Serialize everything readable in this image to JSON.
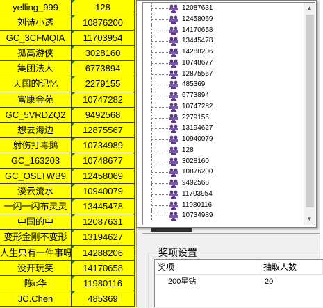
{
  "sheet": {
    "rows": [
      {
        "name": "yelling_999",
        "number": "128"
      },
      {
        "name": "刘诗小透",
        "number": "10876200"
      },
      {
        "name": "GC_3CFMQIA",
        "number": "11703954"
      },
      {
        "name": "孤高游侠",
        "number": "3028160"
      },
      {
        "name": "集团法人",
        "number": "6773894"
      },
      {
        "name": "天国的记忆",
        "number": "2279155"
      },
      {
        "name": "富康金苑",
        "number": "10747282"
      },
      {
        "name": "GC_5VRDZQ2",
        "number": "9492568"
      },
      {
        "name": "想去海边",
        "number": "12875567"
      },
      {
        "name": "射伤打毒鹅",
        "number": "10734989"
      },
      {
        "name": "GC_163203",
        "number": "10748677"
      },
      {
        "name": "GC_OSLTWB9",
        "number": "12458069"
      },
      {
        "name": "淡云流水",
        "number": "10940079"
      },
      {
        "name": "一闪一闪布灵灵",
        "number": "13445478"
      },
      {
        "name": "中国的中",
        "number": "12087631"
      },
      {
        "name": "变形金刚不变形",
        "number": "13194627"
      },
      {
        "name": "人生只有一件事呀",
        "number": "14288206"
      },
      {
        "name": "没开玩笑",
        "number": "14170658"
      },
      {
        "name": "陈c华",
        "number": "11980116"
      },
      {
        "name": "JC.Chen",
        "number": "485369"
      }
    ],
    "colors": {
      "cell_bg": "#ffff00",
      "grid": "#3c3c3c",
      "marker": "#1a7f1a"
    }
  },
  "tree": {
    "node_icon": "user-group-icon",
    "items": [
      "12087631",
      "12458069",
      "14170658",
      "13445478",
      "14288206",
      "10748677",
      "12875567",
      "485369",
      "6773894",
      "10747282",
      "2279155",
      "13194627",
      "10940079",
      "128",
      "3028160",
      "10876200",
      "9492568",
      "11703954",
      "11980116",
      "10734989"
    ],
    "scroll": {
      "up_icon": "scroll-up-arrow-icon",
      "down_icon": "scroll-down-arrow-icon",
      "up_glyph": "▲",
      "down_glyph": "▼"
    }
  },
  "prize": {
    "group_title": "奖项设置",
    "columns": [
      "奖项",
      "抽取人数"
    ],
    "rows": [
      {
        "award": "200星钻",
        "count": "20"
      }
    ]
  }
}
